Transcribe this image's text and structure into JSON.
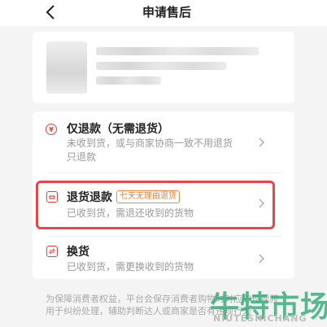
{
  "header": {
    "title": "申请售后",
    "back_icon": "chevron-left-icon"
  },
  "product": {
    "image": "blurred-product-thumbnail"
  },
  "options": [
    {
      "title": "仅退款（无需退货）",
      "desc_line1": "未收到货，或与商家协商一致不用退货",
      "desc_line2": "只退款",
      "icon": "yen-icon"
    },
    {
      "title": "退货退款",
      "badge": "七天无理由退货",
      "desc": "已收到货，需退还收到的货物",
      "icon": "return-box-icon"
    },
    {
      "title": "换货",
      "desc": "已收到货，需更换收到的货物",
      "icon": "exchange-icon"
    }
  ],
  "footer": {
    "note": "为保障消费者权益，平台会保存消费者购物时对应的短视频用于纠纷处理，辅助判断达人或商家是否有违规行为"
  },
  "watermark": {
    "text": "牛特市场",
    "sub": "NIUTESHICHANG"
  },
  "colors": {
    "accent": "#e8413a",
    "badge": "#ef7d2a",
    "highlight": "#e4484a",
    "watermark": "#2aa873"
  }
}
